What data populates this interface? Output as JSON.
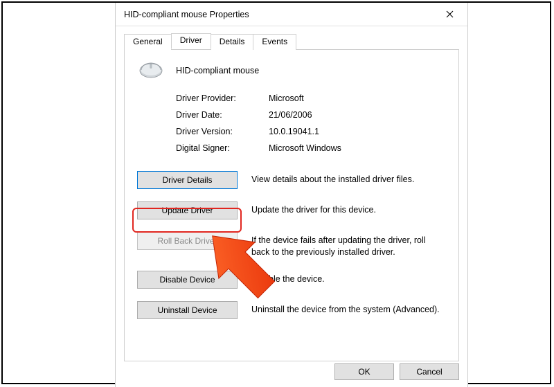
{
  "window": {
    "title": "HID-compliant mouse Properties",
    "device_name": "HID-compliant mouse"
  },
  "tabs": {
    "general": "General",
    "driver": "Driver",
    "details": "Details",
    "events": "Events"
  },
  "info": {
    "provider_label": "Driver Provider:",
    "provider_value": "Microsoft",
    "date_label": "Driver Date:",
    "date_value": "21/06/2006",
    "version_label": "Driver Version:",
    "version_value": "10.0.19041.1",
    "signer_label": "Digital Signer:",
    "signer_value": "Microsoft Windows"
  },
  "actions": {
    "details_label": "Driver Details",
    "details_desc": "View details about the installed driver files.",
    "update_label": "Update Driver",
    "update_desc": "Update the driver for this device.",
    "rollback_label": "Roll Back Driver",
    "rollback_desc": "If the device fails after updating the driver, roll back to the previously installed driver.",
    "disable_label": "Disable Device",
    "disable_desc": "Disable the device.",
    "uninstall_label": "Uninstall Device",
    "uninstall_desc": "Uninstall the device from the system (Advanced)."
  },
  "dialog_buttons": {
    "ok": "OK",
    "cancel": "Cancel"
  },
  "annotation": {
    "arrow_color": "#ff4a11",
    "highlight_color": "#e1261f"
  }
}
